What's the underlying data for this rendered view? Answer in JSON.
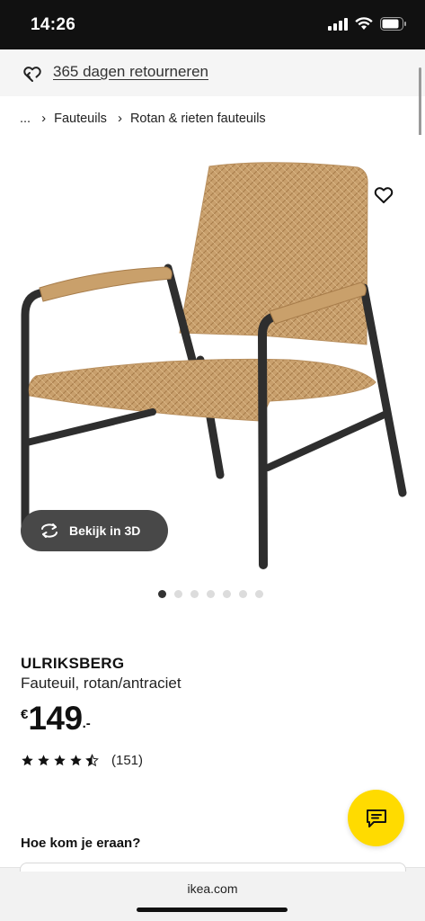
{
  "status_bar": {
    "time": "14:26"
  },
  "banner": {
    "text": "365 dagen retourneren"
  },
  "breadcrumb": {
    "items": [
      "...",
      "Fauteuils",
      "Rotan & rieten fauteuils"
    ]
  },
  "image": {
    "view_3d_label": "Bekijk in 3D",
    "dot_count": 7,
    "active_dot": 0
  },
  "product": {
    "name": "ULRIKSBERG",
    "description": "Fauteuil, rotan/antraciet",
    "price_currency": "€",
    "price_integer": "149",
    "price_decimal": ".-",
    "rating": 4.5,
    "review_count": "(151)"
  },
  "delivery": {
    "heading": "Hoe kom je eraan?"
  },
  "browser": {
    "url": "ikea.com"
  },
  "colors": {
    "accent_yellow": "#ffdb00",
    "pill_gray": "#484848",
    "status_bg": "#111111"
  }
}
